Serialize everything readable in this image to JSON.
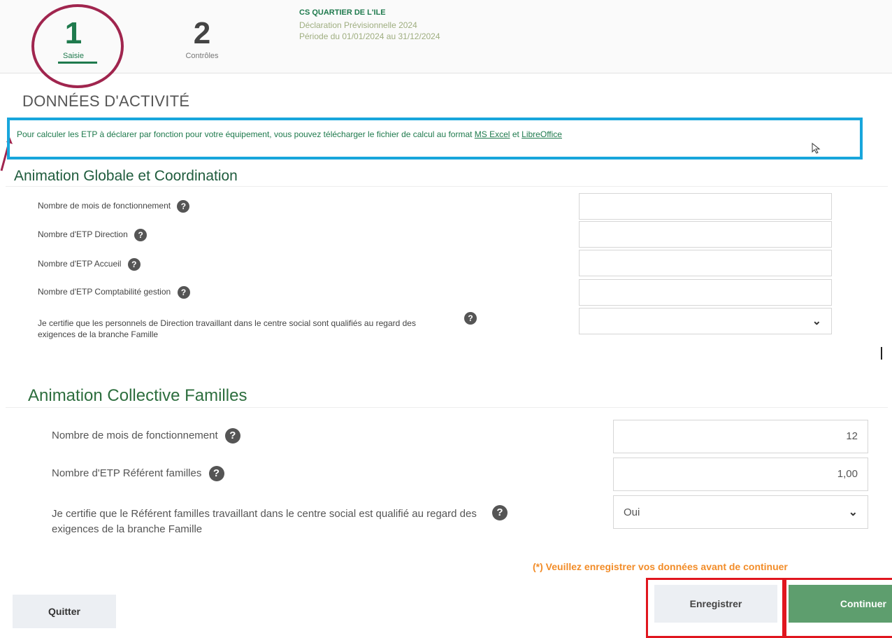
{
  "header": {
    "steps": [
      {
        "num": "1",
        "label": "Saisie"
      },
      {
        "num": "2",
        "label": "Contrôles"
      }
    ],
    "org_name": "CS QUARTIER DE L'ILE",
    "declaration": "Déclaration Prévisionnelle 2024",
    "period": "Période du 01/01/2024 au 31/12/2024"
  },
  "page_title": "DONNÉES D'ACTIVITÉ",
  "info": {
    "text_before": "Pour calculer les ETP à déclarer par fonction pour votre équipement, vous pouvez télécharger le fichier de calcul au format ",
    "link_excel": "MS Excel",
    "conj": " et ",
    "link_libre": "LibreOffice"
  },
  "sections": [
    {
      "title": "Animation Globale et Coordination",
      "fields": [
        {
          "label": "Nombre de mois de fonctionnement",
          "value": ""
        },
        {
          "label": "Nombre d'ETP Direction",
          "value": ""
        },
        {
          "label": "Nombre d'ETP Accueil",
          "value": ""
        },
        {
          "label": "Nombre d'ETP Comptabilité gestion",
          "value": ""
        },
        {
          "label": "Je certifie que les personnels de Direction travaillant dans le centre social sont qualifiés au regard des exigences de la branche Famille",
          "value": ""
        }
      ]
    },
    {
      "title": "Animation Collective Familles",
      "fields": [
        {
          "label": "Nombre de mois de fonctionnement",
          "value": "12"
        },
        {
          "label": "Nombre d'ETP Référent familles",
          "value": "1,00"
        },
        {
          "label": "Je certifie que le Référent familles travaillant dans le centre social est qualifié au regard des exigences de la branche Famille",
          "value": "Oui"
        }
      ]
    }
  ],
  "help_glyph": "?",
  "chevron_glyph": "⌄",
  "warning": "(*) Veuillez enregistrer vos données avant de continuer",
  "buttons": {
    "quit": "Quitter",
    "save": "Enregistrer",
    "continue": "Continuer"
  },
  "colors": {
    "accent_green": "#1f7a4d",
    "highlight_blue": "#18a6dc",
    "highlight_red": "#e0161e",
    "ring": "#a0254e",
    "warning": "#f28c28"
  }
}
